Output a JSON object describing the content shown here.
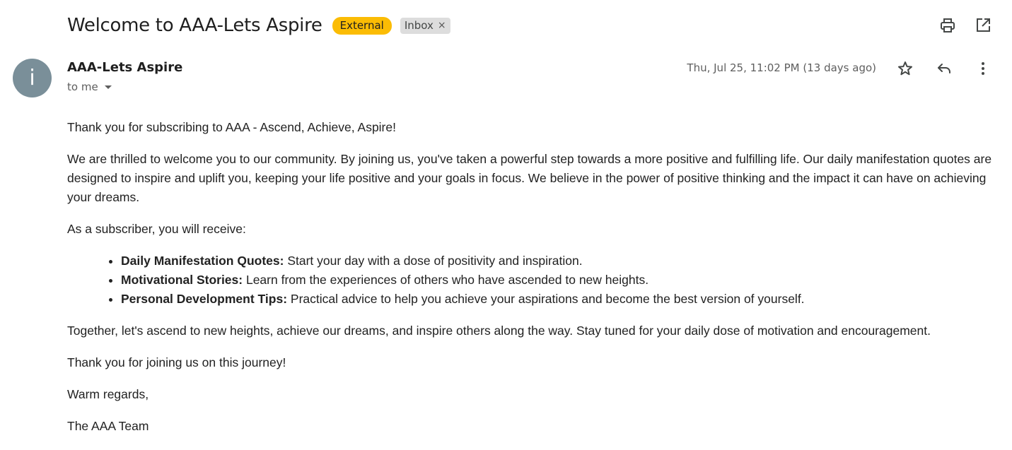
{
  "header": {
    "subject": "Welcome to AAA-Lets Aspire",
    "labels": {
      "external": "External",
      "inbox": "Inbox",
      "remove_symbol": "×"
    }
  },
  "toolbar": {
    "icons": [
      "print-icon",
      "open-in-new-window-icon"
    ]
  },
  "message": {
    "avatar_letter": "i",
    "sender_name": "AAA-Lets Aspire",
    "recipient": "to me",
    "date": "Thu, Jul 25, 11:02 PM (13 days ago)",
    "action_icons": [
      "star-icon",
      "reply-icon",
      "more-vertical-icon"
    ]
  },
  "email_body": {
    "p1": "Thank you for subscribing to AAA - Ascend, Achieve, Aspire!",
    "p2": "We are thrilled to welcome you to our community. By joining us, you've taken a powerful step towards a more positive and fulfilling life. Our daily manifestation quotes are designed to inspire and uplift you, keeping your life positive and your goals in focus. We believe in the power of positive thinking and the impact it can have on achieving your dreams.",
    "p3": "As a subscriber, you will receive:",
    "bullets": [
      {
        "title": "Daily Manifestation Quotes:",
        "text": " Start your day with a dose of positivity and inspiration."
      },
      {
        "title": "Motivational Stories:",
        "text": " Learn from the experiences of others who have ascended to new heights."
      },
      {
        "title": "Personal Development Tips:",
        "text": " Practical advice to help you achieve your aspirations and become the best version of yourself."
      }
    ],
    "p4": "Together, let's ascend to new heights, achieve our dreams, and inspire others along the way. Stay tuned for your daily dose of motivation and encouragement.",
    "p5": "Thank you for joining us on this journey!",
    "p6": "Warm regards,",
    "p7": "The AAA Team"
  },
  "colors": {
    "external_badge": "#fbbc04",
    "inbox_badge": "#dddddd",
    "avatar": "#7a8f99",
    "icon": "#444746"
  }
}
